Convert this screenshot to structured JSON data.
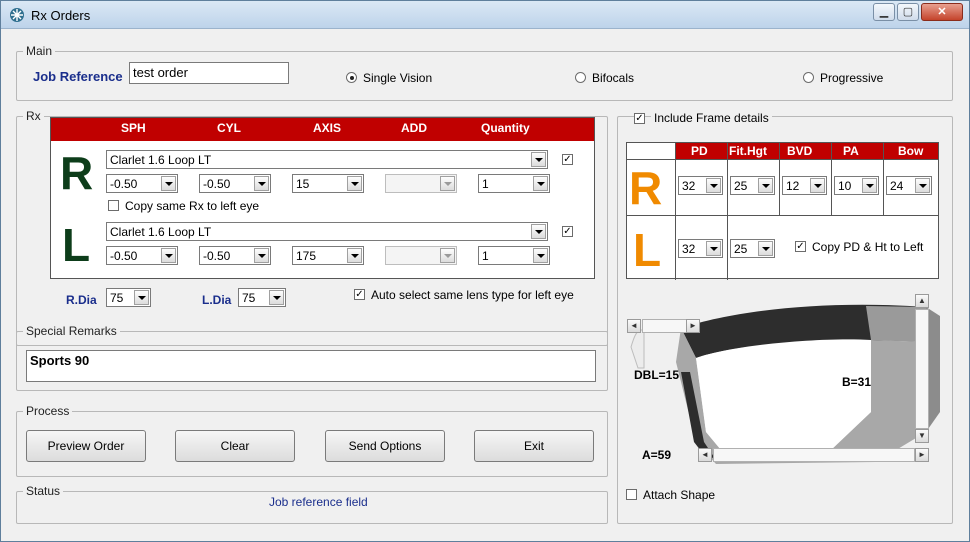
{
  "window": {
    "title": "Rx Orders"
  },
  "main": {
    "legend": "Main",
    "job_reference_label": "Job Reference",
    "job_reference_value": "test order",
    "options": [
      {
        "label": "Single Vision",
        "selected": true
      },
      {
        "label": "Bifocals",
        "selected": false
      },
      {
        "label": "Progressive",
        "selected": false
      }
    ]
  },
  "rx": {
    "legend": "Rx",
    "columns": [
      "SPH",
      "CYL",
      "AXIS",
      "ADD",
      "Quantity"
    ],
    "right": {
      "letter": "R",
      "lens": "Clarlet 1.6 Loop LT",
      "lens_checked": true,
      "sph": "-0.50",
      "cyl": "-0.50",
      "axis": "15",
      "add": "",
      "quantity": "1"
    },
    "copy_same_label": "Copy same Rx to left eye",
    "left": {
      "letter": "L",
      "lens": "Clarlet 1.6 Loop LT",
      "lens_checked": true,
      "sph": "-0.50",
      "cyl": "-0.50",
      "axis": "175",
      "add": "",
      "quantity": "1"
    },
    "rdia_label": "R.Dia",
    "rdia_value": "75",
    "ldia_label": "L.Dia",
    "ldia_value": "75",
    "auto_select_label": "Auto select same lens type for left eye",
    "auto_select_checked": true
  },
  "remarks": {
    "legend": "Special Remarks",
    "value": "Sports 90"
  },
  "process": {
    "legend": "Process",
    "buttons": [
      "Preview Order",
      "Clear",
      "Send Options",
      "Exit"
    ]
  },
  "status": {
    "legend": "Status",
    "text": "Job reference field"
  },
  "frame": {
    "include_label": "Include Frame details",
    "include_checked": true,
    "columns": [
      "PD",
      "Fit.Hgt",
      "BVD",
      "PA",
      "Bow"
    ],
    "right": {
      "letter": "R",
      "pd": "32",
      "fit_hgt": "25",
      "bvd": "12",
      "pa": "10",
      "bow": "24"
    },
    "left": {
      "letter": "L",
      "pd": "32",
      "fit_hgt": "25"
    },
    "copy_label": "Copy PD & Ht to Left",
    "copy_checked": true,
    "dbl": "DBL=15",
    "b": "B=31",
    "a": "A=59",
    "attach_label": "Attach Shape",
    "attach_checked": false
  },
  "colors": {
    "accent_red": "#c00000",
    "dark_green": "#0d3d1a",
    "orange": "#f08a00",
    "label_blue": "#1a2e8c"
  }
}
